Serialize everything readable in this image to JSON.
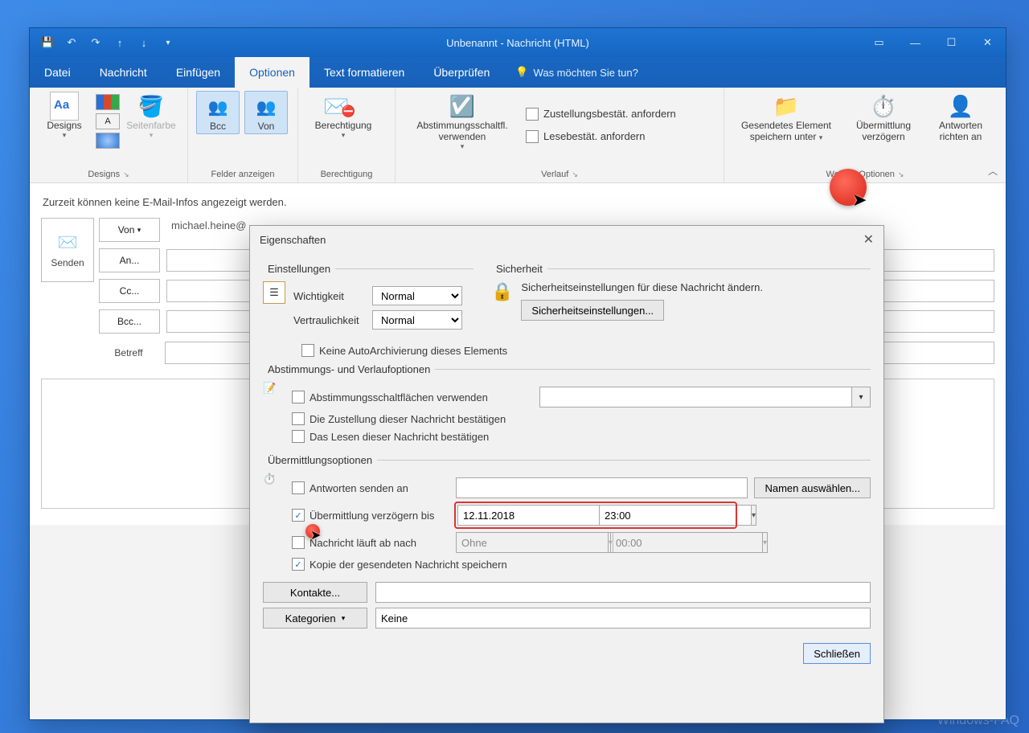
{
  "window": {
    "title": "Unbenannt  -  Nachricht (HTML)"
  },
  "tabs": {
    "file": "Datei",
    "message": "Nachricht",
    "insert": "Einfügen",
    "options": "Optionen",
    "format": "Text formatieren",
    "review": "Überprüfen",
    "tellme": "Was möchten Sie tun?"
  },
  "ribbon": {
    "designs": {
      "title": "Designs",
      "btn": "Designs",
      "pagecolor": "Seitenfarbe"
    },
    "showfields": {
      "title": "Felder anzeigen",
      "bcc": "Bcc",
      "von": "Von"
    },
    "permission": {
      "title": "Berechtigung",
      "btn": "Berechtigung"
    },
    "tracking": {
      "title": "Verlauf",
      "voting": "Abstimmungsschaltfl. verwenden",
      "delivery": "Zustellungsbestät. anfordern",
      "read": "Lesebestät. anfordern"
    },
    "more": {
      "title": "Weitere Optionen",
      "saveSent1": "Gesendetes Element",
      "saveSent2": "speichern unter",
      "delay1": "Übermittlung",
      "delay2": "verzögern",
      "direct1": "Antworten",
      "direct2": "richten an"
    }
  },
  "body": {
    "infobar": "Zurzeit können keine E-Mail-Infos angezeigt werden.",
    "send": "Senden",
    "von": "Von",
    "an": "An...",
    "cc": "Cc...",
    "bcc": "Bcc...",
    "subject": "Betreff",
    "fromValue": "michael.heine@"
  },
  "dialog": {
    "title": "Eigenschaften",
    "settings": {
      "legend": "Einstellungen",
      "importance": "Wichtigkeit",
      "importanceValue": "Normal",
      "sensitivity": "Vertraulichkeit",
      "sensitivityValue": "Normal",
      "noAutoArchive": "Keine AutoArchivierung dieses Elements"
    },
    "security": {
      "legend": "Sicherheit",
      "text": "Sicherheitseinstellungen für diese Nachricht ändern.",
      "btn": "Sicherheitseinstellungen..."
    },
    "voting": {
      "legend": "Abstimmungs- und Verlaufoptionen",
      "useVoting": "Abstimmungsschaltflächen verwenden",
      "confirmDelivery": "Die Zustellung dieser Nachricht bestätigen",
      "confirmRead": "Das Lesen dieser Nachricht bestätigen"
    },
    "delivery": {
      "legend": "Übermittlungsoptionen",
      "replyTo": "Antworten senden an",
      "namesBtn": "Namen auswählen...",
      "delay": "Übermittlung verzögern bis",
      "delayDate": "12.11.2018",
      "delayTime": "23:00",
      "expires": "Nachricht läuft ab nach",
      "expiresDate": "Ohne",
      "expiresTime": "00:00",
      "saveCopy": "Kopie der gesendeten Nachricht speichern",
      "contacts": "Kontakte...",
      "categories": "Kategorien",
      "categoriesValue": "Keine"
    },
    "close": "Schließen"
  },
  "watermark": "Windows-FAQ"
}
